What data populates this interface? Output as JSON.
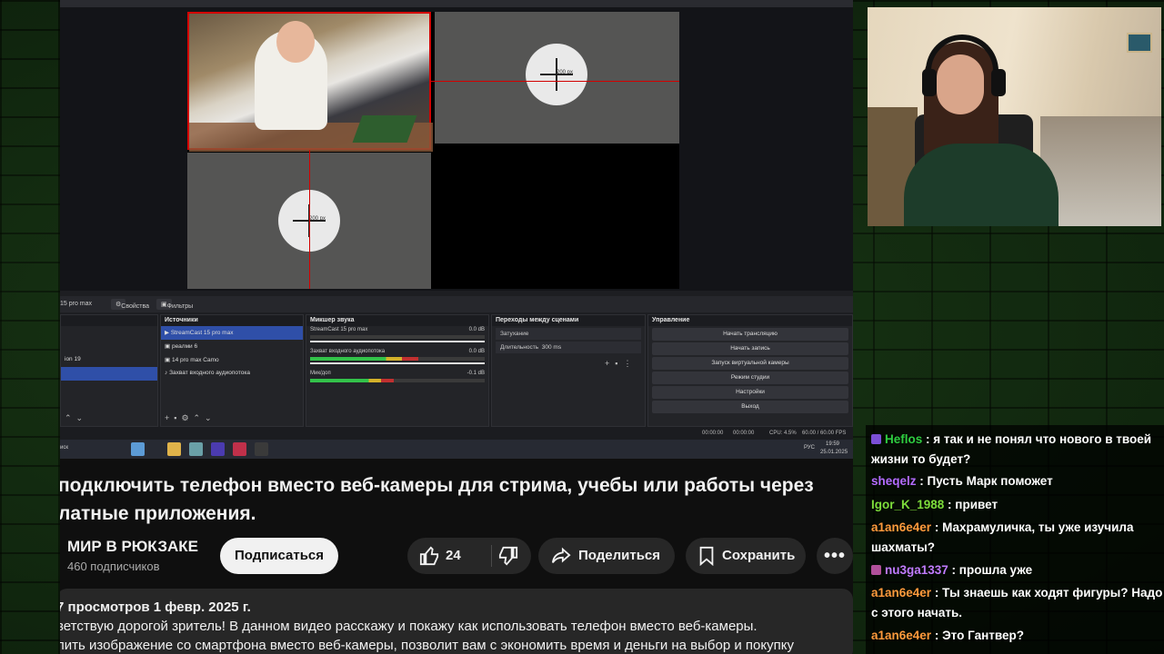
{
  "obs": {
    "tabs": {
      "scene_name": "15 pro max",
      "properties": "Свойства",
      "filters": "Фильтры"
    },
    "preview": {
      "circle_label_1": "200 px",
      "circle_label_2": "200 px"
    },
    "scenes_dock": {
      "rows": [
        "",
        "",
        "ion 19"
      ]
    },
    "sources_dock": {
      "title": "Источники",
      "rows": [
        "StreamCast 15 pro max",
        "реалми 6",
        "14 pro max Camo",
        "Захват входного аудиопотока"
      ]
    },
    "mixer_dock": {
      "title": "Микшер звука",
      "channels": [
        {
          "name": "StreamCast 15 pro max",
          "db": "0.0 dB",
          "level": 0.0
        },
        {
          "name": "Захват входного аудиопотока",
          "db": "0.0 dB",
          "level": 0.62
        },
        {
          "name": "Мик/доп",
          "db": "-0.1 dB",
          "level": 0.48
        }
      ]
    },
    "transitions_dock": {
      "title": "Переходы между сценами",
      "transition": "Затухание",
      "duration_label": "Длительность",
      "duration_value": "300 ms"
    },
    "controls_dock": {
      "title": "Управление",
      "buttons": [
        "Начать трансляцию",
        "Начать запись",
        "Запуск виртуальной камеры",
        "Режим студии",
        "Настройки",
        "Выход"
      ]
    },
    "status": {
      "cpu": "CPU: 4.5%",
      "fps": "60.00 / 60.00 FPS",
      "time1": "00:00:00",
      "time2": "00:00:00"
    },
    "taskbar": {
      "search": "иск",
      "lang": "РУС",
      "time": "19:59",
      "date": "25.01.2025"
    }
  },
  "video_page": {
    "title_line1": "подключить телефон вместо веб-камеры для стрима, учебы или работы через",
    "title_line2": "латные приложения.",
    "channel_name": "МИР В РЮКЗАКЕ",
    "subscribers": "460 подписчиков",
    "subscribe": "Подписаться",
    "likes": "24",
    "share": "Поделиться",
    "save": "Сохранить",
    "views_date": "7 просмотров  1 февр. 2025 г.",
    "desc_line1": "ветствую дорогой зритель! В данном видео расскажу и покажу как использовать телефон вместо веб-камеры.",
    "desc_line2": "лить изображение со смартфона вместо веб-камеры, позволит вам с экономить время и деньги на выбор и покупку"
  },
  "chat": {
    "messages": [
      {
        "nick": "Heflos",
        "color": "#2ecc40",
        "badge": "#7b4fd6",
        "text": "я так и не понял что нового в твоей жизни то будет?"
      },
      {
        "nick": "sheqelz",
        "color": "#b36bff",
        "badge": "",
        "text": "Пусть Марк поможет"
      },
      {
        "nick": "Igor_K_1988",
        "color": "#7ddc3b",
        "badge": "",
        "text": "привет"
      },
      {
        "nick": "a1an6e4er",
        "color": "#ff9a3c",
        "badge": "",
        "text": "Махрамуличка, ты уже изучила шахматы?"
      },
      {
        "nick": "nu3ga1337",
        "color": "#c07bff",
        "badge": "#b0509a",
        "text": "прошла уже"
      },
      {
        "nick": "a1an6e4er",
        "color": "#ff9a3c",
        "badge": "",
        "text": "Ты знаешь как ходят фигуры? Надо с этого начать."
      },
      {
        "nick": "a1an6e4er",
        "color": "#ff9a3c",
        "badge": "",
        "text": "Это Гантвер?"
      }
    ]
  }
}
